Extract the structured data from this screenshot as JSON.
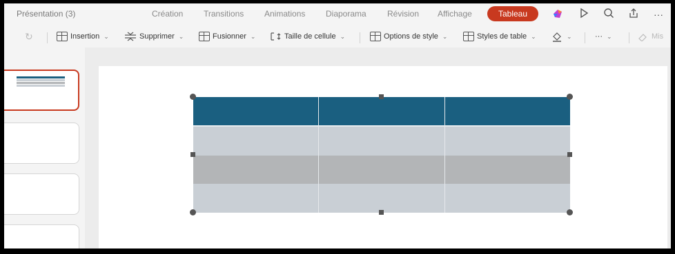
{
  "document": {
    "title": "Présentation (3)"
  },
  "tabs": [
    {
      "label": "Création"
    },
    {
      "label": "Transitions"
    },
    {
      "label": "Animations"
    },
    {
      "label": "Diaporama"
    },
    {
      "label": "Révision"
    },
    {
      "label": "Affichage"
    }
  ],
  "active_tab": {
    "label": "Tableau"
  },
  "top_icons": [
    "copilot-icon",
    "play-icon",
    "search-icon",
    "share-icon",
    "more-icon"
  ],
  "ribbon": {
    "insertion": "Insertion",
    "supprimer": "Supprimer",
    "fusionner": "Fusionner",
    "taille": "Taille de cellule",
    "options": "Options de style",
    "styles": "Styles de table",
    "more": "···",
    "mise": "Mis"
  },
  "colors": {
    "accent": "#c8391f",
    "header_row": "#1a5f80",
    "band_light": "#c9cfd5",
    "band_dark": "#b3b5b7"
  },
  "table": {
    "rows": 4,
    "columns": 3,
    "row_styles": [
      "header",
      "light",
      "dark",
      "light"
    ]
  }
}
